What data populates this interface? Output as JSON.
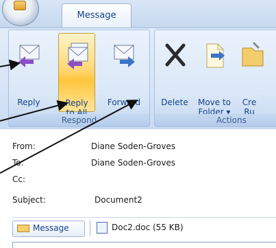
{
  "ribbon": {
    "tab": "Message",
    "respond_group_label": "Respond",
    "actions_group_label": "Actions",
    "buttons": [
      {
        "label": "Reply",
        "label2": ""
      },
      {
        "label": "Reply",
        "label2": "to All"
      },
      {
        "label": "Forward",
        "label2": ""
      },
      {
        "label": "Delete",
        "label2": ""
      },
      {
        "label": "Move to",
        "label2": "Folder ▾"
      },
      {
        "label": "Cre",
        "label2": "Ru"
      }
    ]
  },
  "header": {
    "from_label": "From:",
    "from_value": "Diane Soden-Groves",
    "to_label": "To:",
    "to_value": "Diane Soden-Groves",
    "cc_label": "Cc:",
    "cc_value": "",
    "subject_label": "Subject:",
    "subject_value": "Document2"
  },
  "attachments": {
    "message_tab": "Message",
    "file": "Doc2.doc (55 KB)"
  }
}
